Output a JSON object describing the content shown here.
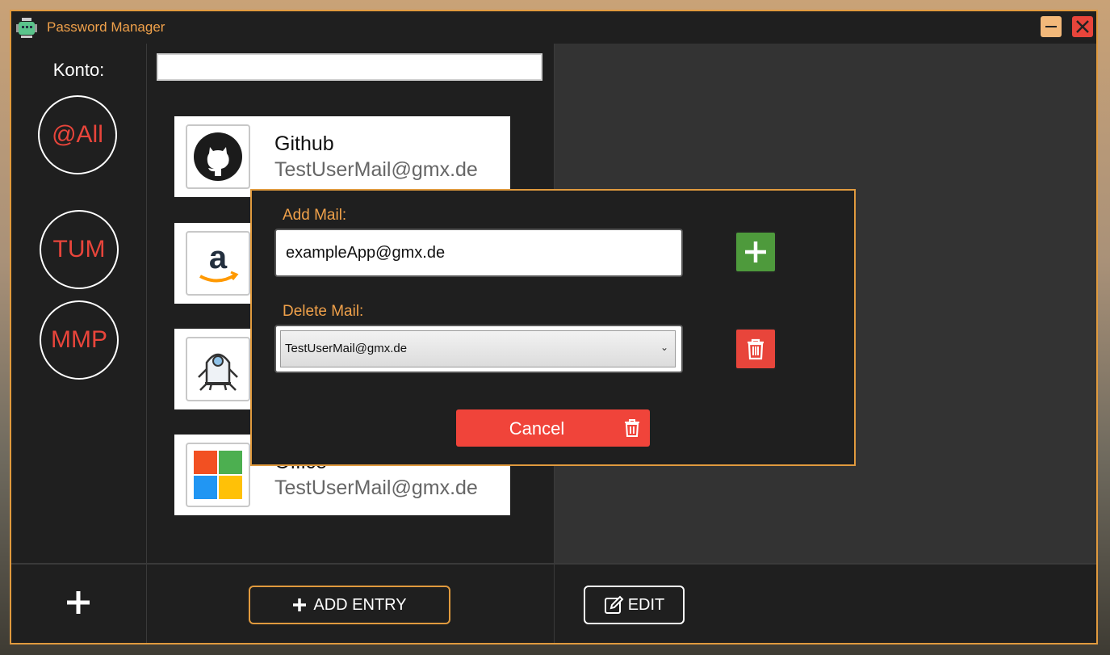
{
  "window": {
    "title": "Password Manager"
  },
  "sidebar": {
    "heading": "Konto:",
    "accounts": [
      {
        "label": "@All"
      },
      {
        "label": "TUM"
      },
      {
        "label": "MMP"
      }
    ]
  },
  "search": {
    "value": ""
  },
  "entries": [
    {
      "name": "Github",
      "mail": "TestUserMail@gmx.de",
      "icon": "github-icon"
    },
    {
      "name": "",
      "mail": "",
      "icon": "amazon-icon"
    },
    {
      "name": "",
      "mail": "",
      "icon": "robot-icon"
    },
    {
      "name": "Office",
      "mail": "TestUserMail@gmx.de",
      "icon": "office-icon"
    }
  ],
  "footer": {
    "add_entry_label": "ADD ENTRY",
    "edit_label": "EDIT"
  },
  "modal": {
    "add_label": "Add Mail:",
    "add_value": "exampleApp@gmx.de",
    "delete_label": "Delete Mail:",
    "delete_selected": "TestUserMail@gmx.de",
    "cancel_label": "Cancel"
  },
  "colors": {
    "accent": "#e09a3e",
    "danger": "#e8453b",
    "success": "#4e9a3c",
    "panel": "#1f1f1f"
  }
}
